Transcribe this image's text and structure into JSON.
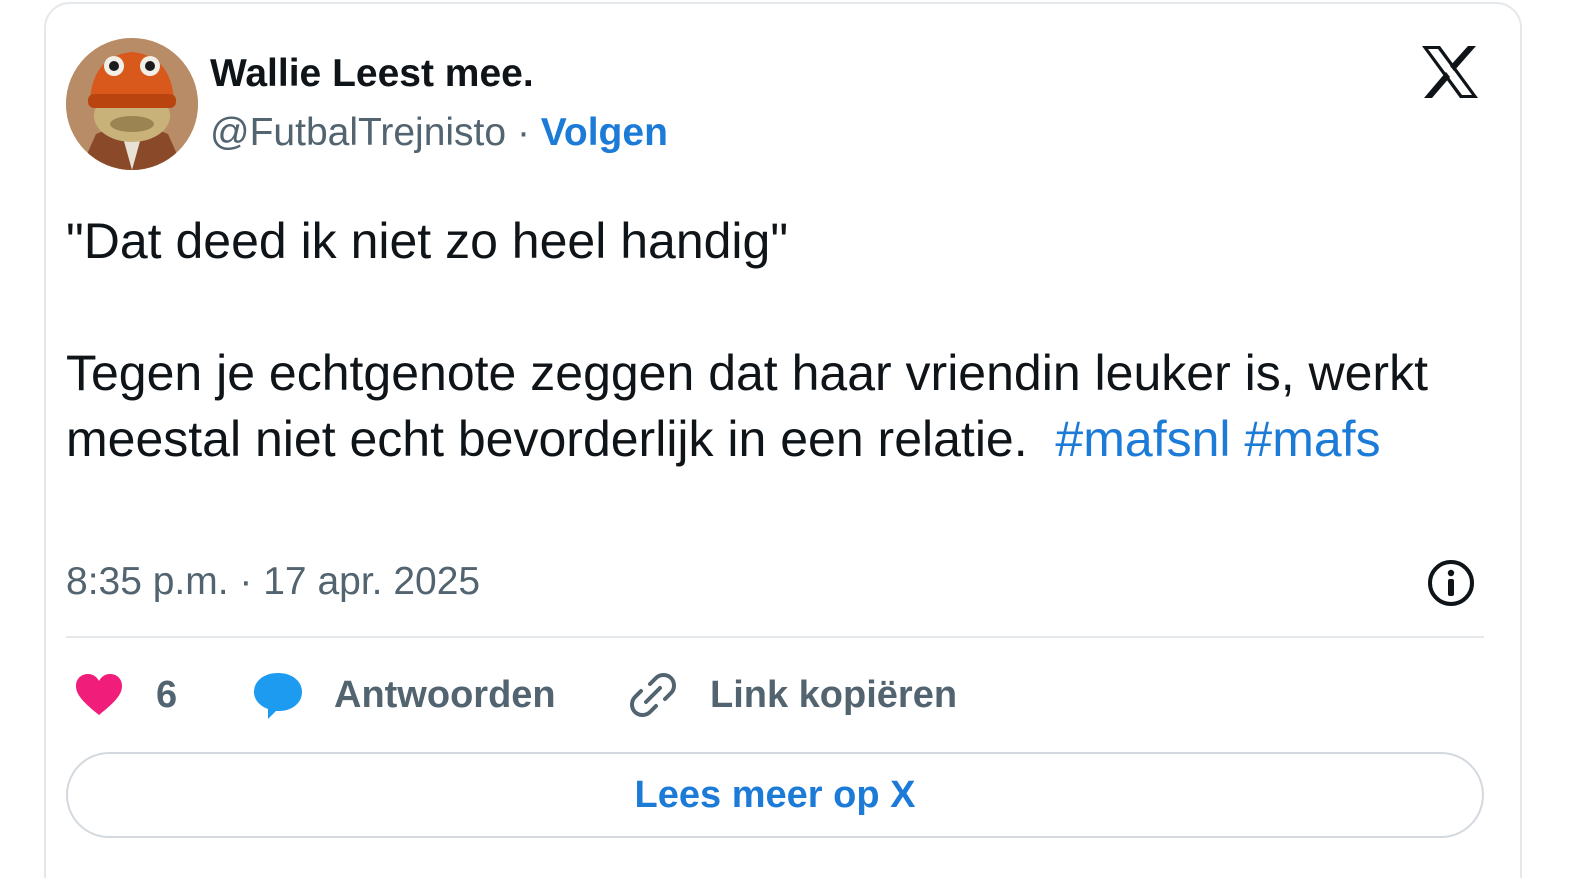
{
  "author": {
    "display_name": "Wallie Leest mee.",
    "handle": "@FutbalTrejnisto",
    "separator": "·",
    "follow_label": "Volgen",
    "avatar_icon": "toad-in-orange-beanie-avatar"
  },
  "brand_icon": "x-logo-icon",
  "tweet": {
    "line1": "\"Dat deed ik niet zo heel handig\"",
    "line2": "Tegen je echtgenote zeggen dat haar vriendin leuker is, werkt meestal niet echt bevorderlijk in een relatie.",
    "hashtags": [
      "#mafsnl",
      "#mafs"
    ]
  },
  "timestamp": "8:35 p.m. · 17 apr. 2025",
  "info_icon": "info-icon",
  "actions": {
    "like": {
      "icon": "heart-icon",
      "count": "6"
    },
    "reply": {
      "icon": "speech-bubble-icon",
      "label": "Antwoorden"
    },
    "copy_link": {
      "icon": "link-icon",
      "label": "Link kopiëren"
    }
  },
  "read_more_label": "Lees meer op X",
  "colors": {
    "link_blue": "#1d7bd8",
    "heart_pink": "#f01e7a",
    "reply_blue": "#1d9bf0",
    "muted_gray": "#536471",
    "border": "#e4e8eb"
  }
}
